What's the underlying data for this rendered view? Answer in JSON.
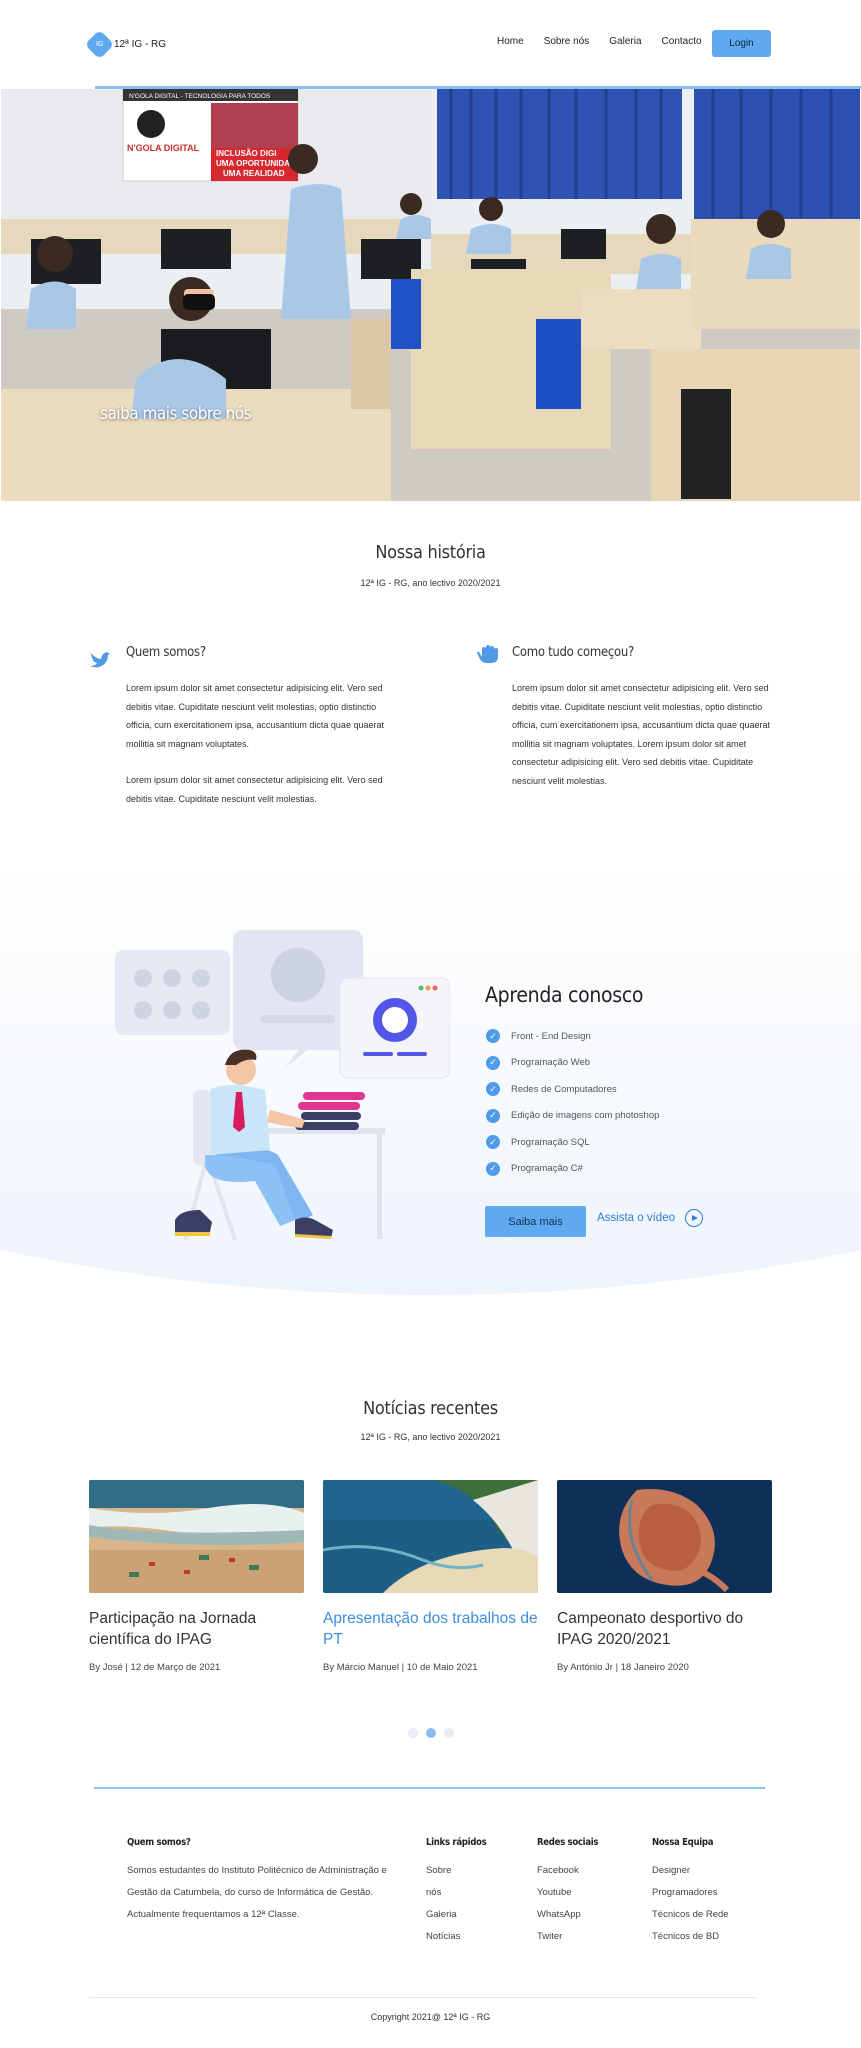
{
  "header": {
    "logo_mark": "IG",
    "logo_text": "12ª IG - RG",
    "nav": [
      "Home",
      "Sobre nós",
      "Galeria",
      "Contacto"
    ],
    "login": "Login"
  },
  "hero": {
    "caption": "saiba mais sobre nós",
    "banner_top": "N'GOLA DIGITAL - TECNOLOGIA PARA TODOS",
    "banner_brand": "N'GOLA DIGITAL",
    "banner_red_1": "INCLUSÃO DIGI",
    "banner_red_2": "UMA OPORTUNIDA",
    "banner_red_3": "UMA REALIDAD"
  },
  "history": {
    "title": "Nossa história",
    "subtitle": "12ª IG - RG, ano lectivo 2020/2021",
    "left": {
      "title": "Quem somos?",
      "p1": "Lorem ipsum dolor sit amet consectetur adipisicing elit. Vero sed debitis vitae. Cupiditate nesciunt velit molestias, optio distinctio officia, cum exercitationem ipsa, accusantium dicta quae quaerat mollitia sit magnam voluptates.",
      "p2": "Lorem ipsum dolor sit amet consectetur adipisicing elit. Vero sed debitis vitae. Cupiditate nesciunt velit molestias."
    },
    "right": {
      "title": "Como tudo começou?",
      "p1": "Lorem ipsum dolor sit amet consectetur adipisicing elit. Vero sed debitis vitae. Cupiditate nesciunt velit molestias, optio distinctio officia, cum exercitationem ipsa, accusantium dicta quae quaerat mollitia sit magnam voluptates. Lorem ipsum dolor sit amet consectetur adipisicing elit. Vero sed debitis vitae. Cupiditate nesciunt velit molestias."
    }
  },
  "learn": {
    "title": "Aprenda conosco",
    "items": [
      "Front - End Design",
      "Programação Web",
      "Redes de Computadores",
      "Edição de imagens com photoshop",
      "Programação SQL",
      "Programação C#"
    ],
    "button": "Saiba mais",
    "video_link": "Assista o vídeo"
  },
  "news": {
    "title": "Notícias recentes",
    "subtitle": "12ª IG - RG, ano lectivo 2020/2021",
    "cards": [
      {
        "title": "Participação na Jornada científica do IPAG",
        "meta": "By José |  12 de Março de 2021"
      },
      {
        "title": "Apresentação dos trabalhos de PT",
        "meta": "By Márcio Manuel | 10 de Maio 2021"
      },
      {
        "title": "Campeonato desportivo do IPAG 2020/2021",
        "meta": "By António Jr | 18 Janeiro 2020"
      }
    ],
    "active_dot": 2
  },
  "footer": {
    "about_title": "Quem somos?",
    "about_text": "Somos estudantes do Instituto Politécnico de Administração e Gestão da Catumbela, do curso de Informática de Gestão. Actualmente frequentamos a 12ª Classe.",
    "links_title": "Links rápidos",
    "links": [
      "Sobre",
      "nós",
      "Galeria",
      "Notícias"
    ],
    "social_title": "Redes sociais",
    "social": [
      "Facebook",
      "Youtube",
      "WhatsApp",
      "Twiter"
    ],
    "team_title": "Nossa Equipa",
    "team": [
      "Designer",
      "Programadores",
      "Técnicos de Rede",
      "Técnicos de BD"
    ],
    "copyright": "Copyright 2021@ 12ª IG - RG"
  },
  "colors": {
    "accent": "#5ea9f0",
    "link_blue": "#2e7ed8",
    "check_blue": "#4f9be8",
    "learn_bg": "#f5f9fd"
  }
}
